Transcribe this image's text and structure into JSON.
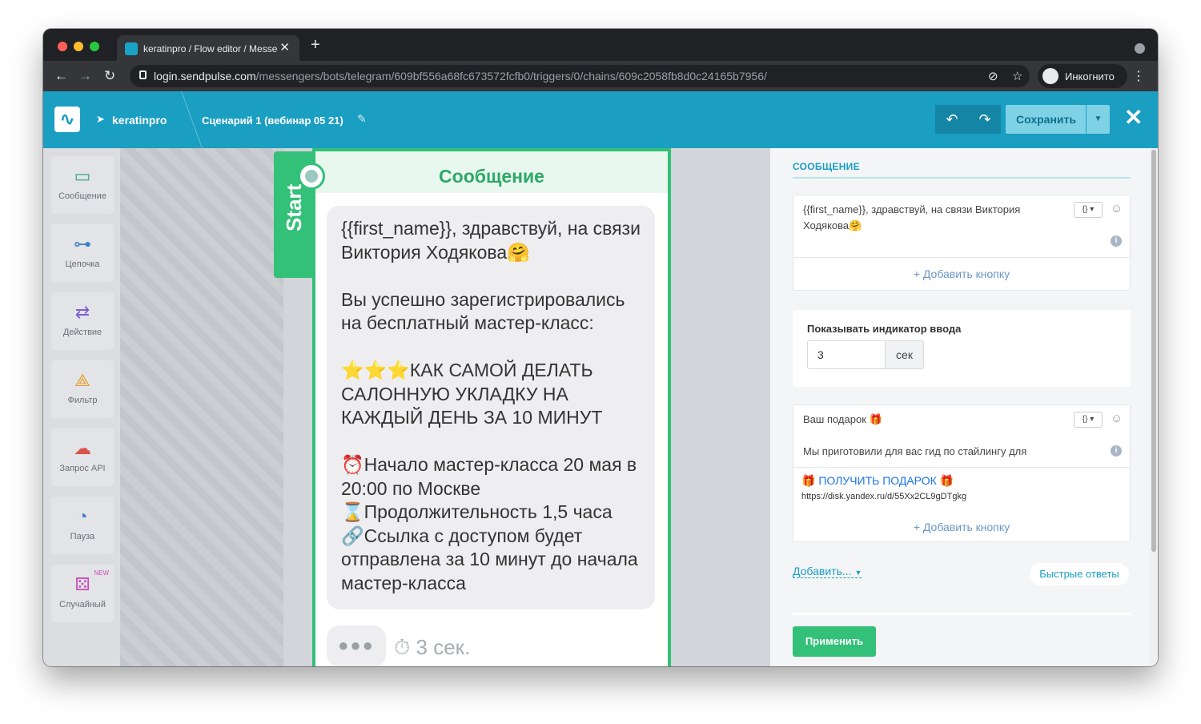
{
  "browser": {
    "tab_title": "keratinpro / Flow editor / Messe",
    "tab_close": "✕",
    "new_tab": "+",
    "url_domain": "login.sendpulse.com",
    "url_path": "/messengers/bots/telegram/609bf556a68fc673572fcfb0/triggers/0/chains/609c2058fb8d0c24165b7956/",
    "profile_label": "Инкогнито",
    "back": "←",
    "forward": "→",
    "reload": "↻",
    "menu": "⋮"
  },
  "header": {
    "bot_name": "keratinpro",
    "scenario_title": "Сценарий 1 (вебинар 05 21)",
    "save_label": "Сохранить",
    "undo": "↶",
    "redo": "↷",
    "close": "✕"
  },
  "sidebar": {
    "items": [
      {
        "label": "Сообщение",
        "icon": "message-icon"
      },
      {
        "label": "Цепочка",
        "icon": "chain-icon"
      },
      {
        "label": "Действие",
        "icon": "action-icon"
      },
      {
        "label": "Фильтр",
        "icon": "filter-icon"
      },
      {
        "label": "Запрос API",
        "icon": "api-request-icon"
      },
      {
        "label": "Пауза",
        "icon": "pause-timer-icon"
      },
      {
        "label": "Случайный",
        "icon": "random-dice-icon",
        "badge": "NEW"
      }
    ]
  },
  "canvas": {
    "start_label": "Start",
    "node_title": "Сообщение",
    "message_text": "{{first_name}}, здравствуй, на связи Виктория Ходякова🤗\n\nВы успешно зарегистрировались на бесплатный мастер-класс:\n\n⭐⭐⭐КАК САМОЙ ДЕЛАТЬ САЛОННУЮ УКЛАДКУ НА КАЖДЫЙ ДЕНЬ ЗА 10 МИНУТ\n\n⏰Начало мастер-класса 20 мая в 20:00 по Москве\n⌛Продолжительность 1,5 часа\n🔗Ссылка с доступом будет отправлена за 10 минут до начала мастер-класса",
    "typing_dots": "●●●",
    "delay_label": "3 сек."
  },
  "panel": {
    "section_title": "СООБЩЕНИЕ",
    "message1_text": "{{first_name}}, здравствуй, на связи Виктория Ходякова🤗",
    "add_button_1": "+ Добавить кнопку",
    "typing_label": "Показывать индикатор ввода",
    "typing_value": "3",
    "typing_unit": "сек",
    "message2_title": "Ваш подарок 🎁",
    "message2_text": "Мы приготовили для вас гид по стайлингу для",
    "gift_button": "🎁 ПОЛУЧИТЬ ПОДАРОК 🎁",
    "gift_link": "https://disk.yandex.ru/d/55Xx2CL9gDTgkg",
    "add_button_2": "+ Добавить кнопку",
    "add_menu": "Добавить...",
    "quick_replies": "Быстрые ответы",
    "apply": "Применить",
    "var_button": "{} ▾"
  },
  "colors": {
    "brand": "#1a9ec2",
    "green": "#33c078"
  }
}
